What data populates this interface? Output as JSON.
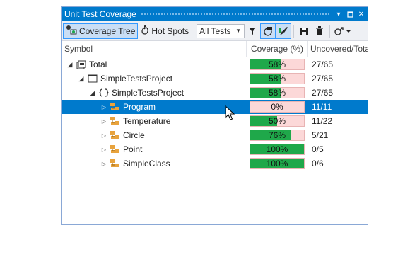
{
  "window": {
    "title": "Unit Test Coverage"
  },
  "title_controls": {
    "dropdown": "▾",
    "pin": "▪",
    "close": "✕"
  },
  "toolbar": {
    "coverage_tree_label": "Coverage Tree",
    "hot_spots_label": "Hot Spots",
    "filter_value": "All Tests",
    "colors": {
      "active_bg": "#c9def5",
      "active_border": "#3399ff"
    }
  },
  "columns": {
    "symbol": "Symbol",
    "coverage": "Coverage (%)",
    "uncovered": "Uncovered/Total"
  },
  "colors": {
    "accent": "#007acc",
    "covered": "#1fa84a",
    "uncovered": "#fcd8d8"
  },
  "rows": [
    {
      "label": "Total",
      "icon": "total-icon",
      "level": 0,
      "expanded": true,
      "coverage_label": "58%",
      "coverage": 0.58,
      "uncovered": "27/65",
      "selected": false
    },
    {
      "label": "SimpleTestsProject",
      "icon": "project-icon",
      "level": 1,
      "expanded": true,
      "coverage_label": "58%",
      "coverage": 0.58,
      "uncovered": "27/65",
      "selected": false
    },
    {
      "label": "SimpleTestsProject",
      "icon": "namespace-icon",
      "level": 2,
      "expanded": true,
      "coverage_label": "58%",
      "coverage": 0.58,
      "uncovered": "27/65",
      "selected": false
    },
    {
      "label": "Program",
      "icon": "class-icon",
      "level": 3,
      "expanded": false,
      "coverage_label": "0%",
      "coverage": 0.0,
      "uncovered": "11/11",
      "selected": true
    },
    {
      "label": "Temperature",
      "icon": "class-icon",
      "level": 3,
      "expanded": false,
      "coverage_label": "50%",
      "coverage": 0.5,
      "uncovered": "11/22",
      "selected": false
    },
    {
      "label": "Circle",
      "icon": "class-icon",
      "level": 3,
      "expanded": false,
      "coverage_label": "76%",
      "coverage": 0.76,
      "uncovered": "5/21",
      "selected": false
    },
    {
      "label": "Point",
      "icon": "class-icon",
      "level": 3,
      "expanded": false,
      "coverage_label": "100%",
      "coverage": 1.0,
      "uncovered": "0/5",
      "selected": false
    },
    {
      "label": "SimpleClass",
      "icon": "class-icon",
      "level": 3,
      "expanded": false,
      "coverage_label": "100%",
      "coverage": 1.0,
      "uncovered": "0/6",
      "selected": false
    }
  ]
}
